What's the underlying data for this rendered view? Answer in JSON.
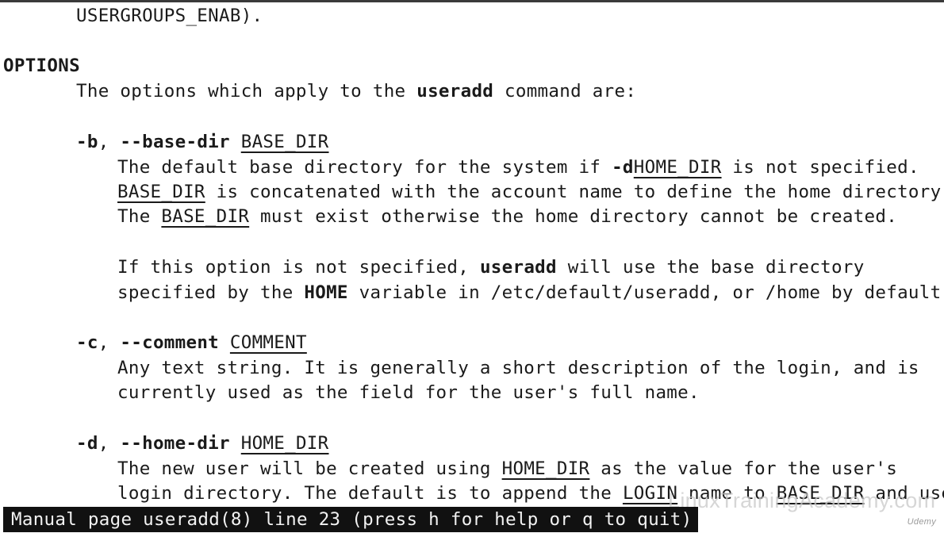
{
  "page": {
    "lines": [
      {
        "id": "l0",
        "parts": [
          {
            "t": "USERGROUPS_ENAB)."
          }
        ]
      },
      {
        "id": "l1",
        "parts": [
          {
            "t": "OPTIONS",
            "b": true
          }
        ]
      },
      {
        "id": "l2",
        "parts": [
          {
            "t": "The options which apply to the "
          },
          {
            "t": "useradd",
            "b": true
          },
          {
            "t": " command are:"
          }
        ]
      },
      {
        "id": "l3",
        "parts": [
          {
            "t": "-b",
            "b": true
          },
          {
            "t": ", "
          },
          {
            "t": "--base-dir",
            "b": true
          },
          {
            "t": " "
          },
          {
            "t": "BASE_DIR",
            "u": true
          }
        ]
      },
      {
        "id": "l4",
        "parts": [
          {
            "t": "The default base directory for the system if "
          },
          {
            "t": "-d",
            "b": true
          },
          {
            "t": "HOME_DIR",
            "u": true
          },
          {
            "t": " is not specified."
          }
        ]
      },
      {
        "id": "l5",
        "parts": [
          {
            "t": "BASE_DIR",
            "u": true
          },
          {
            "t": " is concatenated with the account name to define the home directory."
          }
        ]
      },
      {
        "id": "l6",
        "parts": [
          {
            "t": "The "
          },
          {
            "t": "BASE_DIR",
            "u": true
          },
          {
            "t": " must exist otherwise the home directory cannot be created."
          }
        ]
      },
      {
        "id": "l7",
        "parts": [
          {
            "t": "If this option is not specified, "
          },
          {
            "t": "useradd",
            "b": true
          },
          {
            "t": " will use the base directory"
          }
        ]
      },
      {
        "id": "l8",
        "parts": [
          {
            "t": "specified by the "
          },
          {
            "t": "HOME",
            "b": true
          },
          {
            "t": " variable in /etc/default/useradd, or /home by default."
          }
        ]
      },
      {
        "id": "l9",
        "parts": [
          {
            "t": "-c",
            "b": true
          },
          {
            "t": ", "
          },
          {
            "t": "--comment",
            "b": true
          },
          {
            "t": " "
          },
          {
            "t": "COMMENT",
            "u": true
          }
        ]
      },
      {
        "id": "l10",
        "parts": [
          {
            "t": "Any text string. It is generally a short description of the login, and is"
          }
        ]
      },
      {
        "id": "l11",
        "parts": [
          {
            "t": "currently used as the field for the user's full name."
          }
        ]
      },
      {
        "id": "l12",
        "parts": [
          {
            "t": "-d",
            "b": true
          },
          {
            "t": ", "
          },
          {
            "t": "--home-dir",
            "b": true
          },
          {
            "t": " "
          },
          {
            "t": "HOME_DIR",
            "u": true
          }
        ]
      },
      {
        "id": "l13",
        "parts": [
          {
            "t": "The new user will be created using "
          },
          {
            "t": "HOME_DIR",
            "u": true
          },
          {
            "t": " as the value for the user's"
          }
        ]
      },
      {
        "id": "l14",
        "parts": [
          {
            "t": "login directory. The default is to append the "
          },
          {
            "t": "LOGIN",
            "u": true
          },
          {
            "t": " name to "
          },
          {
            "t": "BASE_DIR",
            "u": true
          },
          {
            "t": " and use"
          }
        ]
      }
    ]
  },
  "status_bar": {
    "text": "Manual page useradd(8) line 23 (press h for help or q to quit)"
  },
  "watermark": {
    "text": "LinuxTrainingAcademy.com",
    "badge": "Udemy"
  },
  "colors": {
    "background": "#ffffff",
    "text": "#1a1a1a",
    "status_bar_bg": "#111111",
    "status_bar_fg": "#f2f2f2"
  }
}
